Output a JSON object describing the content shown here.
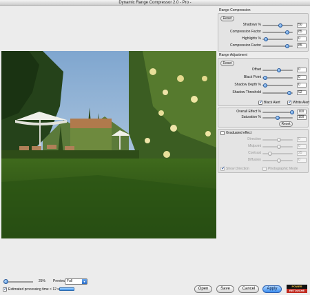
{
  "window": {
    "title": "Dynamic Range Compressor 2.0 - Pro -"
  },
  "range_compression": {
    "title": "Range Compression",
    "reset_label": "Reset",
    "rows": [
      {
        "label": "Shadows %",
        "value": "50",
        "level": 0.6
      },
      {
        "label": "Compression Factor",
        "value": "85",
        "level": 0.82
      },
      {
        "label": "Highlights %",
        "value": "0",
        "level": 0.12
      },
      {
        "label": "Compression Factor",
        "value": "85",
        "level": 0.82
      }
    ]
  },
  "range_adjustment": {
    "title": "Range Adjustment",
    "reset_label": "Reset",
    "rows": [
      {
        "label": "Offset",
        "value": "0",
        "level": 0.55
      },
      {
        "label": "Black Point",
        "value": "0",
        "level": 0.1
      },
      {
        "label": "Shadow Depth %",
        "value": "0",
        "level": 0.1
      },
      {
        "label": "Shadow Threshold",
        "value": "92",
        "level": 0.88
      }
    ],
    "black_alert": {
      "label": "Black Alert",
      "checked": true
    },
    "white_alert": {
      "label": "White Alert",
      "checked": true
    }
  },
  "overall": {
    "rows": [
      {
        "label": "Overall Effect %",
        "value": "100",
        "level": 0.98
      },
      {
        "label": "Saturation %",
        "value": "100",
        "level": 0.5
      }
    ],
    "reset_label": "Reset"
  },
  "graduated": {
    "label": "Graduated effect",
    "checked": false,
    "rows": [
      {
        "label": "Direction",
        "value": "0",
        "level": 0.55
      },
      {
        "label": "Midpoint",
        "value": "0",
        "level": 0.55
      },
      {
        "label": "Contrast",
        "value": "25",
        "level": 0.25
      },
      {
        "label": "Diffusion",
        "value": "0",
        "level": 0.55
      }
    ],
    "show_direction": {
      "label": "Show Direction",
      "checked": true
    },
    "photographic_mode": {
      "label": "Photographic Mode",
      "checked": false
    }
  },
  "bottom": {
    "zoom_value": "25%",
    "zoom_level": 0.05,
    "preview_label": "Preview",
    "preview_selected": "Full",
    "estimate_label": "Estimated processing time < 12 sec.",
    "estimate_checked": true,
    "buttons": {
      "open": "Open",
      "save": "Save",
      "cancel": "Cancel",
      "apply": "Apply"
    },
    "logo": {
      "line1": "POWER",
      "line2": "RETOUCHE"
    }
  },
  "icons": {
    "check": "check-icon",
    "dropdown": "dropdown-arrow-icon"
  },
  "colors": {
    "accent": "#3a7fd0",
    "apply_button": "#3d8ef0",
    "logo_red": "#c0281e",
    "logo_gold": "#f5c542"
  }
}
